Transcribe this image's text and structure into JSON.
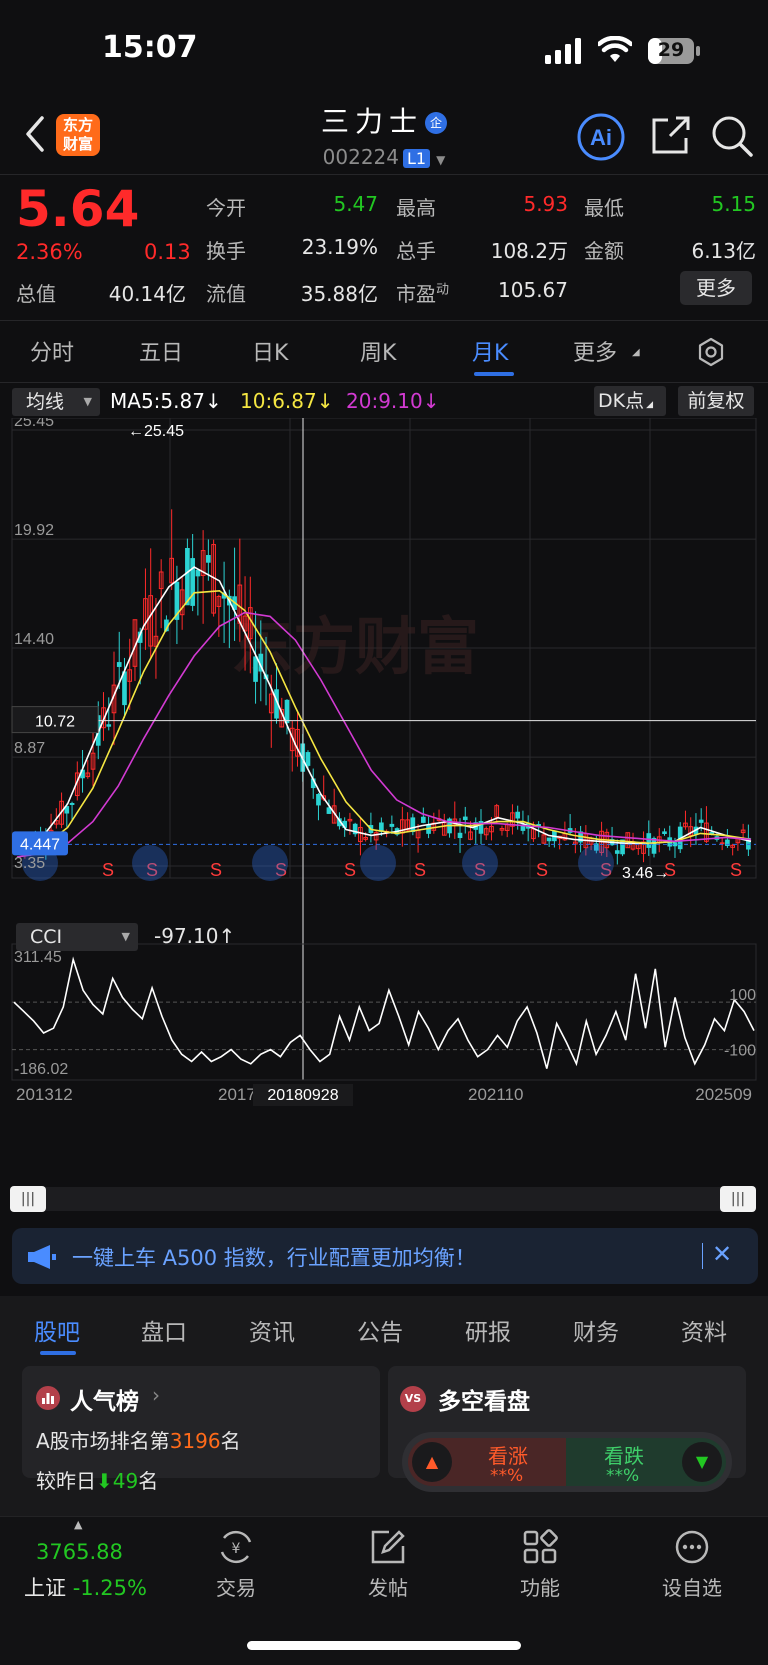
{
  "status": {
    "time": "15:07",
    "battery": "29"
  },
  "header": {
    "logo_line1": "东方",
    "logo_line2": "财富",
    "stock_name": "三力士",
    "name_badge": "企",
    "code": "002224",
    "level_badge": "L1"
  },
  "quote": {
    "price": "5.64",
    "change_pct": "2.36%",
    "change": "0.13",
    "open_label": "今开",
    "open": "5.47",
    "high_label": "最高",
    "high": "5.93",
    "low_label": "最低",
    "low": "5.15",
    "turnover_label": "换手",
    "turnover": "23.19%",
    "volume_label": "总手",
    "volume": "108.2万",
    "amount_label": "金额",
    "amount": "6.13亿",
    "mktcap_label": "总值",
    "mktcap": "40.14亿",
    "float_label": "流值",
    "float_cap": "35.88亿",
    "pe_label": "市盈",
    "pe_sup": "动",
    "pe": "105.67",
    "more_label": "更多"
  },
  "period_tabs": [
    {
      "label": "分时"
    },
    {
      "label": "五日"
    },
    {
      "label": "日K"
    },
    {
      "label": "周K"
    },
    {
      "label": "月K",
      "active": true
    },
    {
      "label": "更多"
    }
  ],
  "indicator": {
    "ma_select": "均线",
    "ma5": "MA5:5.87",
    "ma10": "10:6.87",
    "ma20": "20:9.10",
    "dk_label": "DK点",
    "adjust_label": "前复权"
  },
  "colors": {
    "up": "#ff2a2a",
    "down": "#2bd3d3",
    "ma5": "#ffffff",
    "ma10": "#f5e642",
    "ma20": "#d23ad2",
    "accent": "#2f6fe4"
  },
  "chart_data": {
    "type": "line",
    "title": "",
    "price_axis_ticks": [
      "25.45",
      "19.92",
      "14.40",
      "8.87",
      "3.35"
    ],
    "ylim": [
      3.35,
      25.45
    ],
    "crosshair_price": "10.72",
    "current_price_tag": "4.447",
    "max_label": "←25.45",
    "min_label": "3.46→",
    "x_tick_labels": [
      "201312",
      "201711",
      "202110",
      "202509"
    ],
    "crosshair_date": "20180928",
    "watermark": "东方财富",
    "sell_marker": "S",
    "series": [
      {
        "name": "MA5",
        "values": [
          4.2,
          4.8,
          6.5,
          9.5,
          12.5,
          15.5,
          17.5,
          18.5,
          17.8,
          15.2,
          12.5,
          9.5,
          7.0,
          5.2,
          4.9,
          5.1,
          5.4,
          5.6,
          5.3,
          5.8,
          5.5,
          4.9,
          4.7,
          4.6,
          4.5,
          4.5,
          4.6,
          5.3,
          4.9,
          4.6
        ]
      },
      {
        "name": "MA10",
        "values": [
          4.0,
          4.3,
          5.3,
          7.3,
          10.2,
          13.2,
          15.6,
          17.2,
          17.3,
          16.3,
          14.2,
          11.4,
          8.8,
          6.6,
          5.2,
          5.0,
          5.2,
          5.4,
          5.4,
          5.6,
          5.6,
          5.2,
          4.9,
          4.7,
          4.6,
          4.5,
          4.6,
          5.0,
          4.9,
          4.7
        ]
      },
      {
        "name": "MA20",
        "values": [
          3.8,
          4.0,
          4.5,
          5.6,
          7.4,
          9.8,
          12.0,
          14.0,
          15.5,
          16.2,
          16.0,
          14.8,
          12.8,
          10.5,
          8.2,
          6.7,
          6.0,
          5.6,
          5.5,
          5.5,
          5.4,
          5.3,
          5.1,
          4.9,
          4.8,
          4.7,
          4.6,
          4.7,
          4.8,
          4.7
        ]
      }
    ]
  },
  "cci": {
    "select_label": "CCI",
    "value_label": "-97.10↑",
    "ticks": [
      "311.45",
      "-186.02"
    ],
    "ref_high": "100",
    "ref_low": "-100",
    "ylim": [
      -186.02,
      311.45
    ],
    "values": [
      100,
      60,
      20,
      -30,
      -10,
      80,
      280,
      150,
      90,
      50,
      200,
      120,
      70,
      30,
      160,
      40,
      -60,
      -120,
      -150,
      -110,
      -150,
      -130,
      -100,
      -140,
      -160,
      -120,
      -100,
      -130,
      -70,
      -40,
      -100,
      -150,
      -120,
      40,
      -60,
      80,
      -20,
      10,
      150,
      40,
      -80,
      60,
      -10,
      -100,
      -20,
      30,
      -60,
      -130,
      -100,
      -40,
      -90,
      20,
      80,
      -30,
      -180,
      10,
      -70,
      -160,
      20,
      -120,
      -40,
      60,
      -60,
      220,
      -10,
      240,
      -90,
      120,
      -50,
      -160,
      -80,
      30,
      -20,
      110,
      60,
      -20
    ]
  },
  "banner": {
    "text": "一键上车 A500 指数，行业配置更加均衡！"
  },
  "section_tabs": [
    {
      "label": "股吧",
      "active": true
    },
    {
      "label": "盘口"
    },
    {
      "label": "资讯"
    },
    {
      "label": "公告"
    },
    {
      "label": "研报"
    },
    {
      "label": "财务"
    },
    {
      "label": "资料"
    }
  ],
  "popularity": {
    "title": "人气榜",
    "rank_prefix": "A股市场排名第",
    "rank": "3196",
    "rank_suffix": "名",
    "change_prefix": "较昨日",
    "change": "49",
    "change_suffix": "名"
  },
  "longshort": {
    "title": "多空看盘",
    "vs_badge": "VS",
    "bull_label": "看涨",
    "bull_value": "**%",
    "bear_label": "看跌",
    "bear_value": "**%"
  },
  "bottom_nav": {
    "index_value": "3765.88",
    "index_name": "上证",
    "index_change": "-1.25%",
    "items": [
      {
        "label": "交易",
        "icon": "yuan-refresh-icon"
      },
      {
        "label": "发帖",
        "icon": "edit-icon"
      },
      {
        "label": "功能",
        "icon": "grid-icon"
      },
      {
        "label": "设自选",
        "icon": "more-dots-icon"
      }
    ]
  }
}
